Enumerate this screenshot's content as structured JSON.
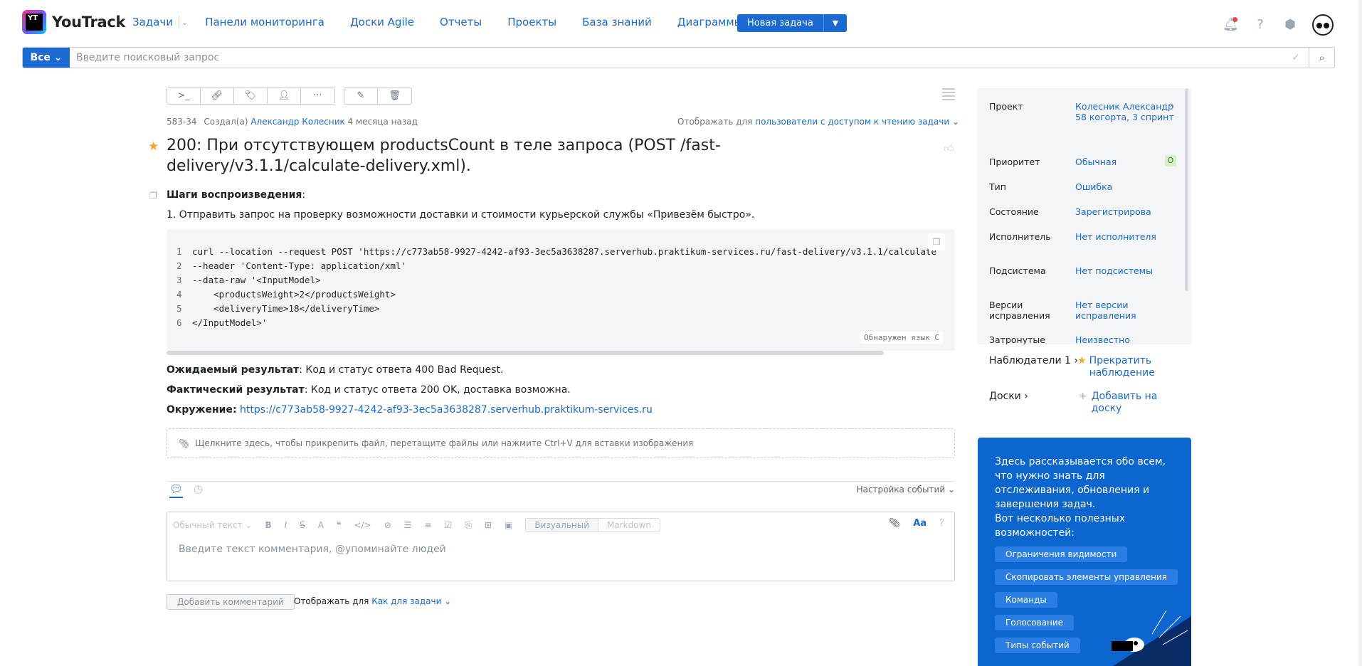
{
  "app": {
    "logo_text": "YouTrack",
    "logo_badge": "YT"
  },
  "nav": {
    "items": [
      "Задачи",
      "Панели мониторинга",
      "Доски Agile",
      "Отчеты",
      "Проекты",
      "База знаний",
      "Диаграммы Ганта"
    ],
    "new_task": "Новая задача"
  },
  "search": {
    "scope": "Все",
    "placeholder": "Введите поисковый запрос"
  },
  "issue": {
    "id": "583-34",
    "created_prefix": "Создал(а)",
    "author": "Александр Колесник",
    "created_ago": "4 месяца назад",
    "visibility_prefix": "Отображать для",
    "visibility_value": "пользователи с доступом к чтению задачи",
    "title": "200: При отсутствующем productsCount в теле запроса (POST /fast-delivery/v3.1.1/calculate-delivery.xml).",
    "steps_heading": "Шаги воспроизведения",
    "step_1": "1. Отправить запрос на проверку возможности доставки и стоимости курьерской службы «Привезём быстро».",
    "code_lines": [
      "curl --location --request POST 'https://c773ab58-9927-4242-af93-3ec5a3638287.serverhub.praktikum-services.ru/fast-delivery/v3.1.1/calculate",
      "--header 'Content-Type: application/xml'",
      "--data-raw '<InputModel>",
      "    <productsWeight>2</productsWeight>",
      "    <deliveryTime>18</deliveryTime>",
      "</InputModel>'"
    ],
    "code_lang": "Обнаружен язык C",
    "expected_label": "Ожидаемый результат",
    "expected_text": ": Код и статус ответа 400 Bad Request.",
    "actual_label": "Фактический результат",
    "actual_text": ": Код и статус ответа 200 OK, доставка возможна.",
    "env_label": "Окружение:",
    "env_link": "https://c773ab58-9927-4242-af93-3ec5a3638287.serverhub.praktikum-services.ru",
    "attach_hint": "Щелкните здесь, чтобы прикрепить файл, перетащите файлы или нажмите Ctrl+V для вставки изображения"
  },
  "comments": {
    "event_settings": "Настройка событий",
    "format_select": "Обычный текст",
    "mode_visual": "Визуальный",
    "mode_markdown": "Markdown",
    "font_toggle": "Aa",
    "placeholder": "Введите текст комментария, @упоминайте людей",
    "add_button": "Добавить комментарий",
    "show_for_prefix": "Отображать для",
    "show_for_value": "Как для задачи"
  },
  "fields": [
    {
      "name": "Проект",
      "value": "Колесник Александр 58 когорта, 3 спринт"
    },
    {
      "name": "Приоритет",
      "value": "Обычная",
      "badge": "O"
    },
    {
      "name": "Тип",
      "value": "Ошибка"
    },
    {
      "name": "Состояние",
      "value": "Зарегистрирова"
    },
    {
      "name": "Исполнитель",
      "value": "Нет исполнителя"
    },
    {
      "name": "Подсистема",
      "value": "Нет подсистемы"
    },
    {
      "name": "Версии исправления",
      "value": "Нет версии исправления"
    },
    {
      "name": "Затронутые",
      "value": "Неизвестно"
    }
  ],
  "watchers": {
    "label": "Наблюдатели 1",
    "action": "Прекратить наблюдение"
  },
  "boards": {
    "label": "Доски",
    "action": "Добавить на доску"
  },
  "promo": {
    "text": "Здесь рассказывается обо всем, что нужно знать для отслеживания, обновления и завершения задач.",
    "text2": "Вот несколько полезных возможностей:",
    "chips": [
      "Ограничения видимости",
      "Скопировать элементы управления",
      "Команды",
      "Голосование",
      "Типы событий"
    ]
  },
  "colors": {
    "accent": "#1a6ad1",
    "promo_bg": "#0d66d0",
    "star": "#f0a82b"
  }
}
